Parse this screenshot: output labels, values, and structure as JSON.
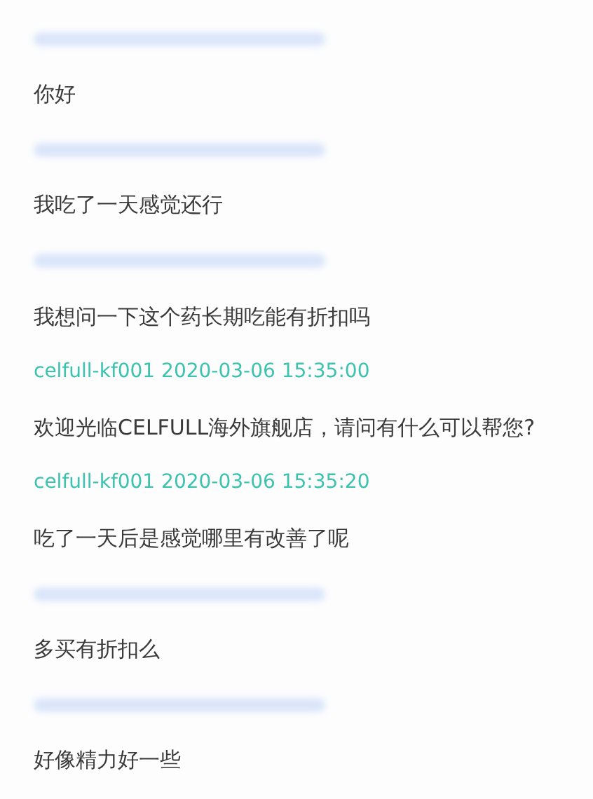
{
  "entries": [
    {
      "kind": "blurred"
    },
    {
      "kind": "message",
      "text": "你好"
    },
    {
      "kind": "blurred"
    },
    {
      "kind": "message",
      "text": "我吃了一天感觉还行"
    },
    {
      "kind": "blurred"
    },
    {
      "kind": "message",
      "text": "我想问一下这个药长期吃能有折扣吗"
    },
    {
      "kind": "header",
      "text": "celfull-kf001 2020-03-06 15:35:00"
    },
    {
      "kind": "message",
      "text": "欢迎光临CELFULL海外旗舰店，请问有什么可以帮您?"
    },
    {
      "kind": "header",
      "text": "celfull-kf001 2020-03-06 15:35:20"
    },
    {
      "kind": "message",
      "text": "吃了一天后是感觉哪里有改善了呢"
    },
    {
      "kind": "blurred"
    },
    {
      "kind": "message",
      "text": "多买有折扣么"
    },
    {
      "kind": "blurred"
    },
    {
      "kind": "message",
      "text": "好像精力好一些"
    }
  ]
}
